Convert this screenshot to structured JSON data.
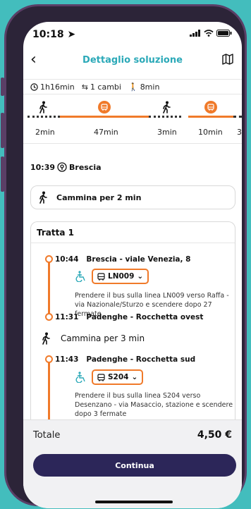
{
  "status_bar": {
    "time": "10:18"
  },
  "header": {
    "title": "Dettaglio soluzione"
  },
  "summary": {
    "duration": "1h16min",
    "changes": "1 cambi",
    "walk": "8min"
  },
  "legs": [
    {
      "type": "walk",
      "duration": "2min"
    },
    {
      "type": "bus",
      "duration": "47min"
    },
    {
      "type": "walk",
      "duration": "3min"
    },
    {
      "type": "bus",
      "duration": "10min"
    },
    {
      "type": "walk",
      "duration": "3"
    }
  ],
  "departure": {
    "time": "10:39",
    "place": "Brescia"
  },
  "walk_first": {
    "label": "Cammina per 2 min"
  },
  "tratta": {
    "title": "Tratta 1",
    "segments": [
      {
        "time": "10:44",
        "stop": "Brescia - viale Venezia, 8",
        "line": "LN009",
        "instruction": "Prendere il bus sulla linea LN009 verso Raffa - via Nazionale/Sturzo e scendere dopo 27 fermate",
        "arrive_time": "11:31",
        "arrive_stop": "Padenghe - Rocchetta ovest"
      },
      {
        "time": "11:43",
        "stop": "Padenghe - Rocchetta sud",
        "line": "S204",
        "instruction": "Prendere il bus sulla linea S204 verso Desenzano - via Masaccio, stazione e scendere dopo 3 fermate"
      }
    ],
    "mid_walk": "Cammina per 3 min"
  },
  "footer": {
    "total_label": "Totale",
    "total_value": "4,50 €",
    "continue_label": "Continua"
  },
  "colors": {
    "accent": "#f07a2a",
    "title": "#2ba9b8",
    "primary_button": "#2c2659",
    "background": "#43bdbd"
  }
}
